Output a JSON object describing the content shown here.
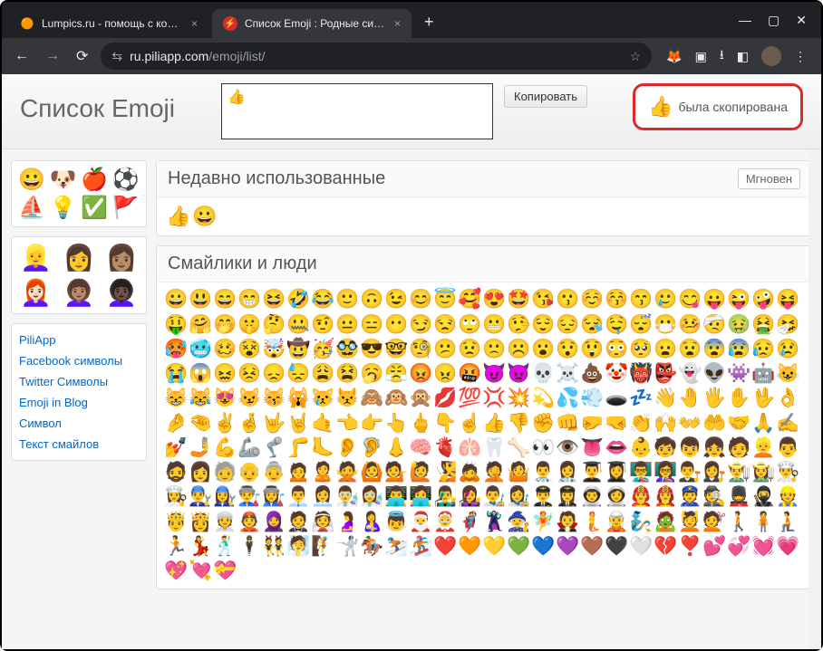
{
  "tabs": [
    {
      "title": "Lumpics.ru - помощь с компь",
      "favicon": "🟠"
    },
    {
      "title": "Список Emoji : Родные символ",
      "favicon": "⚡"
    }
  ],
  "url": {
    "prefix_icon": "⇆",
    "domain": "ru.piliapp.com",
    "path": "/emoji/list/"
  },
  "page_title": "Список Emoji",
  "textarea_value": "👍",
  "copy_label": "Копировать",
  "copied_notice": {
    "icon": "👍",
    "text": "была скопирована"
  },
  "sidebar": {
    "categories": [
      "😀",
      "🐶",
      "🍎",
      "⚽",
      "⛵",
      "💡",
      "✅",
      "🚩"
    ],
    "people": [
      "👱‍♀️",
      "👩",
      "👩🏽",
      "👩🏻‍🦰",
      "👩🏽‍🦱",
      "👩🏿‍🦱"
    ],
    "links": [
      "PiliApp",
      "Facebook символы",
      "Twitter Символы",
      "Emoji in Blog",
      "Символ",
      "Текст смайлов"
    ]
  },
  "sections": {
    "recent": {
      "title": "Недавно использованные",
      "instant": "Мгновен",
      "items": [
        "👍",
        "😀"
      ]
    },
    "smileys": {
      "title": "Смайлики и люди",
      "items": [
        "😀",
        "😃",
        "😄",
        "😁",
        "😆",
        "🤣",
        "😂",
        "🙂",
        "🙃",
        "😉",
        "😊",
        "😇",
        "🥰",
        "😍",
        "🤩",
        "😘",
        "😗",
        "☺️",
        "😚",
        "😙",
        "🥲",
        "😋",
        "😛",
        "😜",
        "🤪",
        "😝",
        "🤑",
        "🤗",
        "🤭",
        "🤫",
        "🤔",
        "🤐",
        "🤨",
        "😐",
        "😑",
        "😶",
        "😏",
        "😒",
        "🙄",
        "😬",
        "🤥",
        "😌",
        "😔",
        "😪",
        "🤤",
        "😴",
        "😷",
        "🤒",
        "🤕",
        "🤢",
        "🤮",
        "🤧",
        "🥵",
        "🥶",
        "🥴",
        "😵",
        "🤯",
        "🤠",
        "🥳",
        "🥸",
        "😎",
        "🤓",
        "🧐",
        "😕",
        "😟",
        "🙁",
        "☹️",
        "😮",
        "😯",
        "😲",
        "😳",
        "🥺",
        "😦",
        "😧",
        "😨",
        "😰",
        "😥",
        "😢",
        "😭",
        "😱",
        "😖",
        "😣",
        "😞",
        "😓",
        "😩",
        "😫",
        "🥱",
        "😤",
        "😡",
        "😠",
        "🤬",
        "😈",
        "👿",
        "💀",
        "☠️",
        "💩",
        "🤡",
        "👹",
        "👺",
        "👻",
        "👽",
        "👾",
        "🤖",
        "😺",
        "😸",
        "😹",
        "😻",
        "😼",
        "😽",
        "🙀",
        "😿",
        "😾",
        "🙈",
        "🙉",
        "🙊",
        "💋",
        "💯",
        "💢",
        "💥",
        "💫",
        "💦",
        "💨",
        "🕳️",
        "💤",
        "👋",
        "🤚",
        "🖐️",
        "✋",
        "🖖",
        "👌",
        "🤌",
        "🤏",
        "✌️",
        "🤞",
        "🤟",
        "🤘",
        "🤙",
        "👈",
        "👉",
        "👆",
        "🖕",
        "👇",
        "☝️",
        "👍",
        "👎",
        "✊",
        "👊",
        "🤛",
        "🤜",
        "👏",
        "🙌",
        "👐",
        "🤲",
        "🤝",
        "🙏",
        "✍️",
        "💅",
        "🤳",
        "💪",
        "🦾",
        "🦿",
        "🦵",
        "🦶",
        "👂",
        "🦻",
        "👃",
        "🧠",
        "🫀",
        "🫁",
        "🦷",
        "🦴",
        "👀",
        "👁️",
        "👅",
        "👄",
        "👶",
        "🧒",
        "👦",
        "👧",
        "🧑",
        "👱",
        "👨",
        "🧔",
        "👩",
        "🧓",
        "👴",
        "👵",
        "🙍",
        "🙎",
        "🙅",
        "🙆",
        "💁",
        "🙋",
        "🧏",
        "🙇",
        "🤦",
        "🤷",
        "👨‍⚕️",
        "👩‍⚕️",
        "👨‍🎓",
        "👩‍🎓",
        "👨‍🏫",
        "👩‍🏫",
        "👨‍⚖️",
        "👩‍⚖️",
        "👨‍🌾",
        "👩‍🌾",
        "👨‍🍳",
        "👩‍🍳",
        "👨‍🔧",
        "👩‍🔧",
        "👨‍🏭",
        "👩‍🏭",
        "👨‍💼",
        "👩‍💼",
        "👨‍🔬",
        "👩‍🔬",
        "👨‍💻",
        "👩‍💻",
        "👨‍🎤",
        "👩‍🎤",
        "👨‍🎨",
        "👩‍🎨",
        "👨‍✈️",
        "👩‍✈️",
        "👨‍🚀",
        "👩‍🚀",
        "👨‍🚒",
        "👩‍🚒",
        "👮",
        "🕵️",
        "💂",
        "🥷",
        "👷",
        "🤴",
        "👸",
        "👳",
        "👲",
        "🧕",
        "🤵",
        "👰",
        "🤰",
        "🤱",
        "👼",
        "🎅",
        "🤶",
        "🦸",
        "🦹",
        "🧙",
        "🧚",
        "🧛",
        "🧜",
        "🧝",
        "🧞",
        "🧟",
        "💆",
        "💇",
        "🚶",
        "🧍",
        "🧎",
        "🏃",
        "💃",
        "🕺",
        "🕴️",
        "👯",
        "🧖",
        "🧗",
        "🤺",
        "🏇",
        "⛷️",
        "🏂",
        "❤️",
        "🧡",
        "💛",
        "💚",
        "💙",
        "💜",
        "🤎",
        "🖤",
        "🤍",
        "💔",
        "❣️",
        "💕",
        "💞",
        "💓",
        "💗",
        "💖",
        "💘",
        "💝"
      ]
    }
  }
}
